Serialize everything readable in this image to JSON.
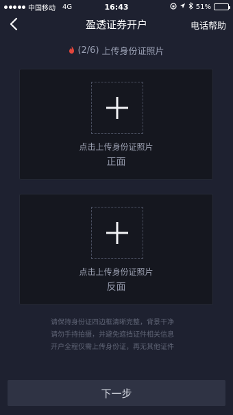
{
  "status_bar": {
    "carrier": "中国移动",
    "network": "4G",
    "time": "16:43",
    "battery_percent": "51%",
    "battery_level": 0.51
  },
  "nav": {
    "title": "盈透证券开户",
    "help": "电话帮助"
  },
  "step": {
    "progress": "(2/6)",
    "label": "上传身份证照片"
  },
  "cards": {
    "front": {
      "label": "点击上传身份证照片",
      "side": "正面"
    },
    "back": {
      "label": "点击上传身份证照片",
      "side": "反面"
    }
  },
  "hints": [
    "请保持身份证四边框清晰完整，背景干净",
    "请勿手持拍摄，并避免遮挡证件相关信息",
    "开户全程仅需上传身份证，再无其他证件"
  ],
  "next_button": "下一步"
}
